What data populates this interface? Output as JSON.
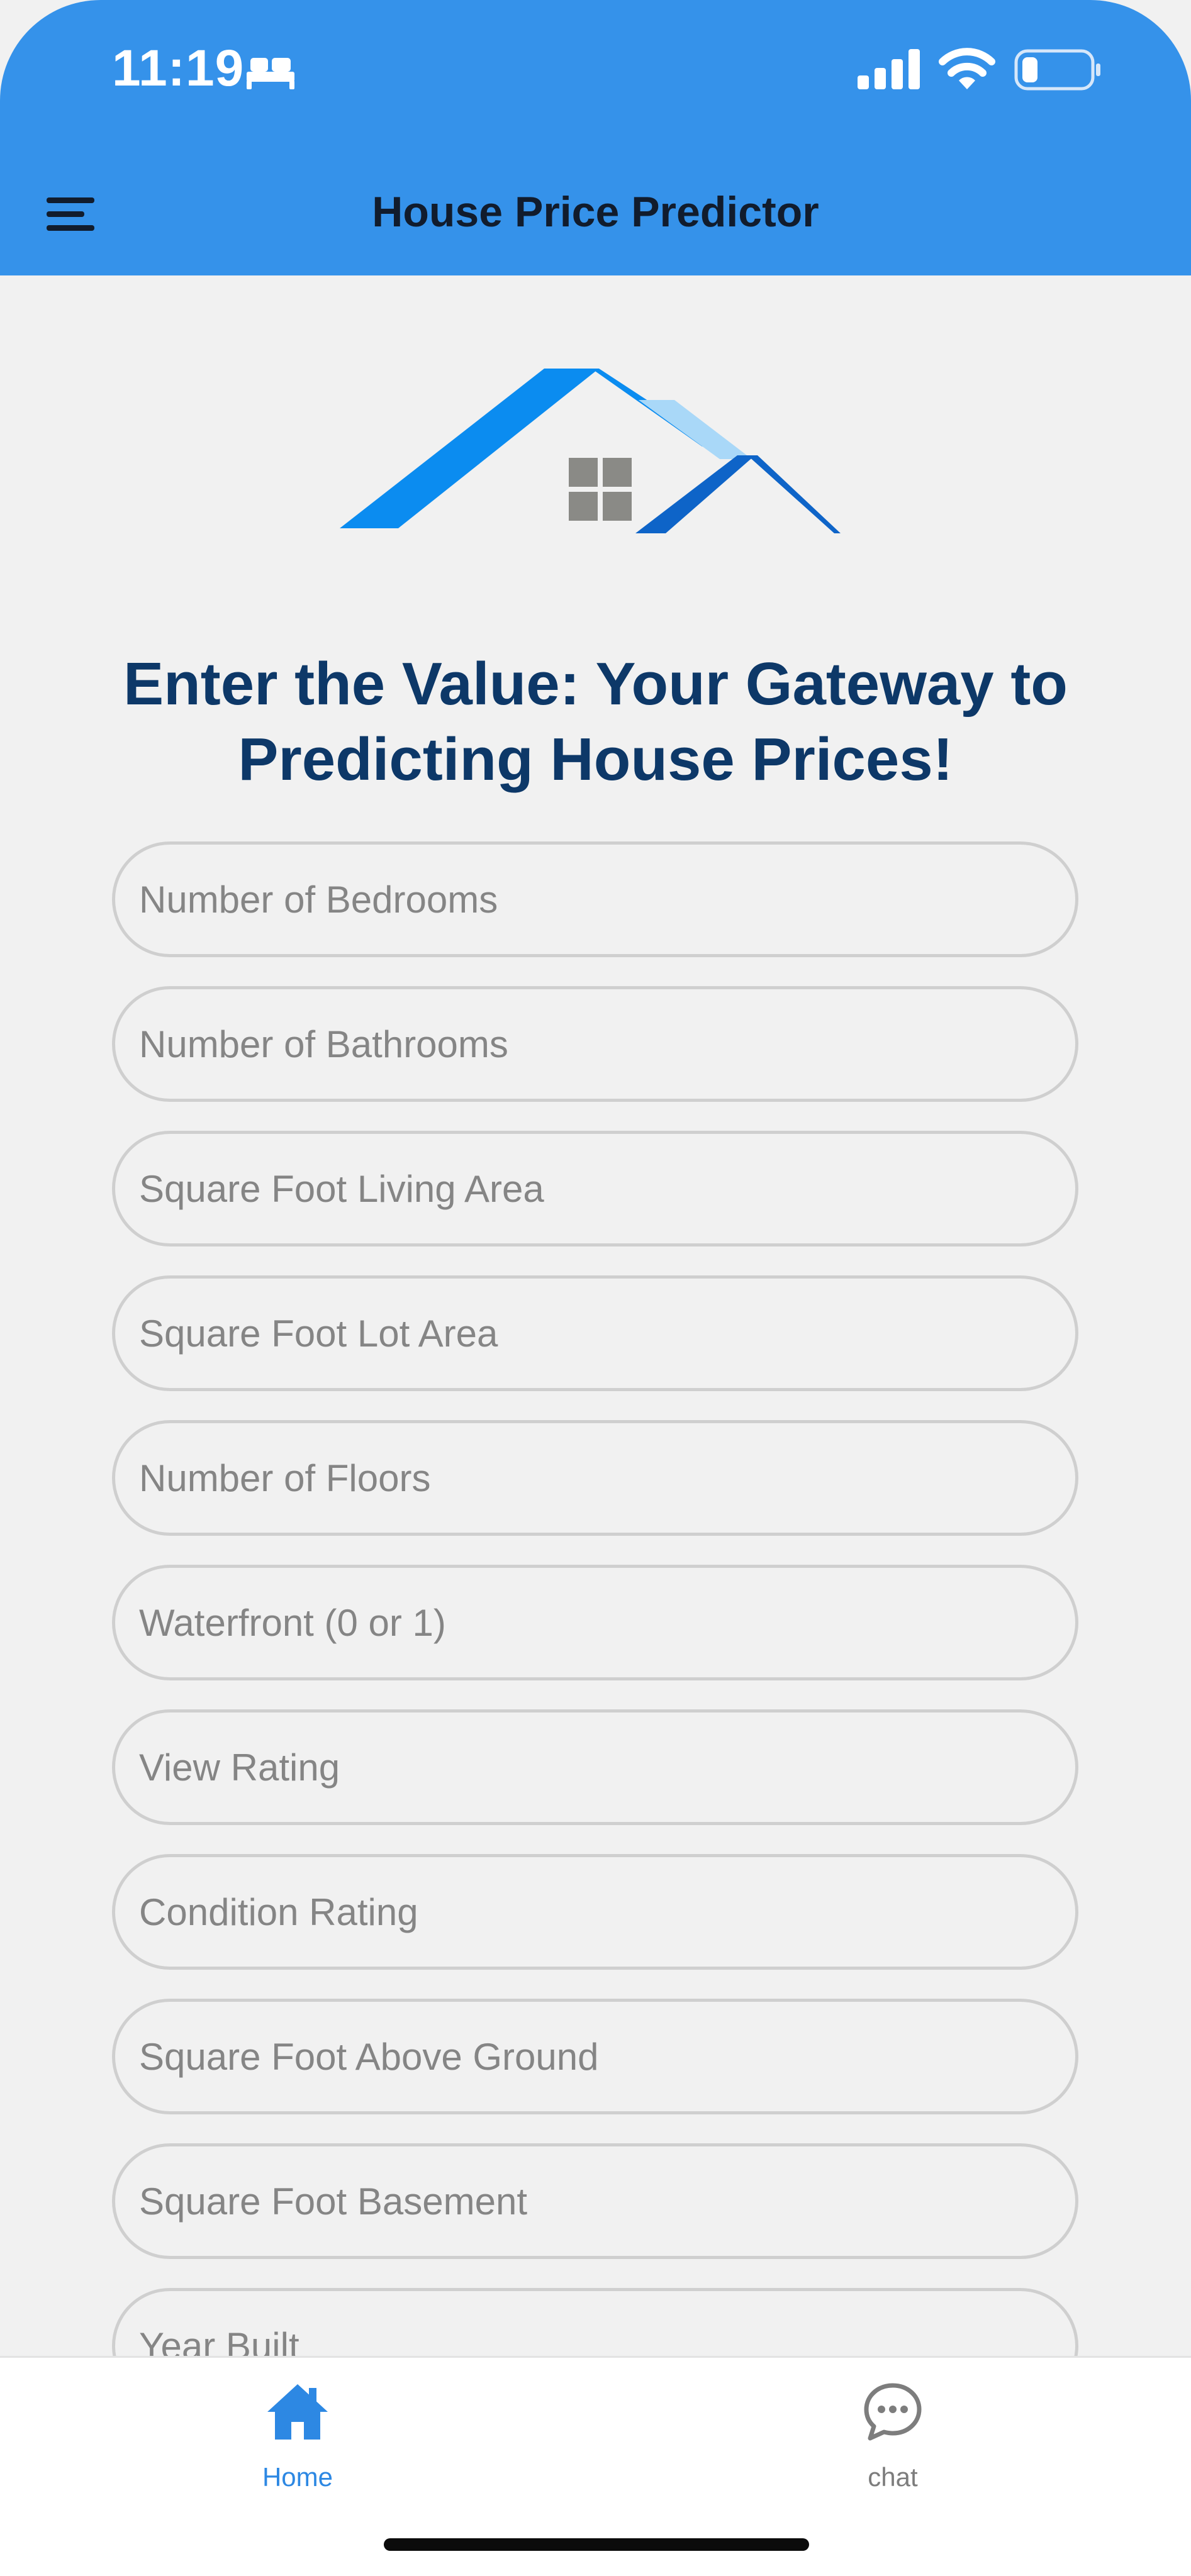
{
  "status_bar": {
    "time": "11:19",
    "icons": [
      "bed-icon",
      "cellular-signal-icon",
      "wifi-icon",
      "battery-icon"
    ],
    "battery_level": 0.2
  },
  "header": {
    "title": "House Price Predictor",
    "menu_icon": "hamburger-menu-icon",
    "background_color": "#3592ea"
  },
  "logo": {
    "icon": "house-roof-logo"
  },
  "headline": "Enter the Value: Your Gateway to Predicting House Prices!",
  "form": {
    "fields": [
      {
        "placeholder": "Number of Bedrooms",
        "value": ""
      },
      {
        "placeholder": "Number of Bathrooms",
        "value": ""
      },
      {
        "placeholder": "Square Foot Living Area",
        "value": ""
      },
      {
        "placeholder": "Square Foot Lot Area",
        "value": ""
      },
      {
        "placeholder": "Number of Floors",
        "value": ""
      },
      {
        "placeholder": "Waterfront (0 or 1)",
        "value": ""
      },
      {
        "placeholder": "View Rating",
        "value": ""
      },
      {
        "placeholder": "Condition Rating",
        "value": ""
      },
      {
        "placeholder": "Square Foot Above Ground",
        "value": ""
      },
      {
        "placeholder": "Square Foot Basement",
        "value": ""
      },
      {
        "placeholder": "Year Built",
        "value": ""
      }
    ]
  },
  "tab_bar": {
    "tabs": [
      {
        "label": "Home",
        "icon": "home-icon",
        "active": true
      },
      {
        "label": "chat",
        "icon": "chat-bubble-icon",
        "active": false
      }
    ],
    "active_color": "#2d88e3",
    "inactive_color": "#7d7d7d"
  },
  "colors": {
    "headline": "#0d3868",
    "page_background": "#f1f1f1"
  }
}
